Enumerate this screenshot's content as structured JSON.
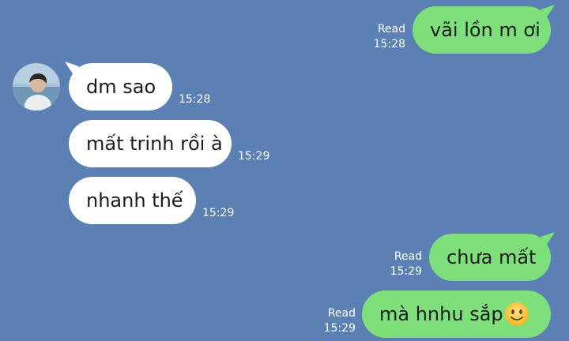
{
  "contact": {
    "avatar_icon": "contact-avatar-icon"
  },
  "messages": [
    {
      "direction": "out",
      "text": "vãi lồn m ơi",
      "status": "Read",
      "time": "15:28"
    },
    {
      "direction": "in",
      "text": "dm sao",
      "time": "15:28"
    },
    {
      "direction": "in",
      "text": "mất trinh rồi à",
      "time": "15:29"
    },
    {
      "direction": "in",
      "text": "nhanh thế",
      "time": "15:29"
    },
    {
      "direction": "out",
      "text": "chưa mất",
      "status": "Read",
      "time": "15:29"
    },
    {
      "direction": "out",
      "text": "mà hnhu sắp",
      "emoji": "slightly-smiling-face-icon",
      "status": "Read",
      "time": "15:29"
    }
  ],
  "colors": {
    "background": "#5b80b4",
    "outgoing": "#7ee07a",
    "incoming": "#ffffff",
    "meta_text": "#ffffff"
  }
}
